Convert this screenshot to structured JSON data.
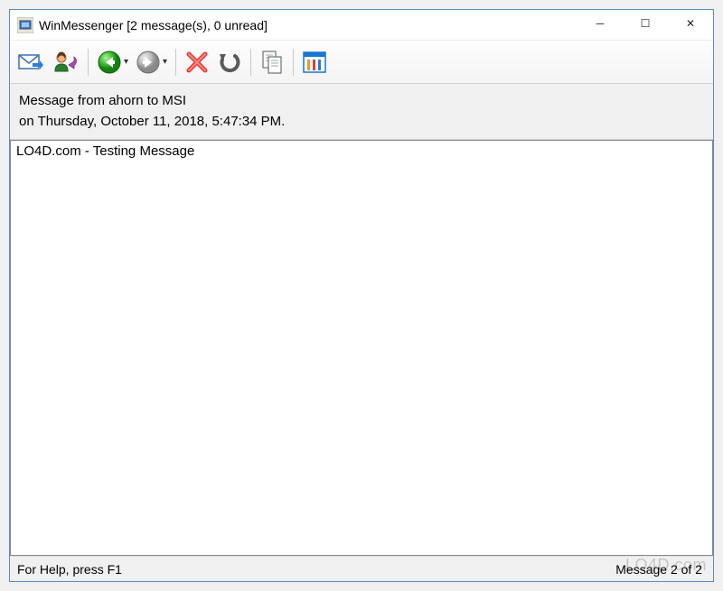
{
  "titlebar": {
    "title": "WinMessenger [2 message(s), 0 unread]"
  },
  "window_controls": {
    "minimize": "─",
    "maximize": "☐",
    "close": "✕"
  },
  "toolbar": {
    "items": [
      {
        "name": "new-message-icon"
      },
      {
        "name": "reply-sender-icon"
      },
      {
        "name": "previous-icon",
        "dropdown": true
      },
      {
        "name": "next-icon",
        "dropdown": true
      },
      {
        "name": "delete-icon"
      },
      {
        "name": "undo-icon"
      },
      {
        "name": "copy-icon"
      },
      {
        "name": "options-icon"
      }
    ]
  },
  "info": {
    "line1": "Message from ahorn to MSI",
    "line2": "on Thursday, October 11, 2018, 5:47:34 PM."
  },
  "message": {
    "body": "LO4D.com - Testing Message"
  },
  "statusbar": {
    "help": "For Help, press F1",
    "counter": "Message 2 of 2"
  },
  "watermark": "LO4D.com"
}
